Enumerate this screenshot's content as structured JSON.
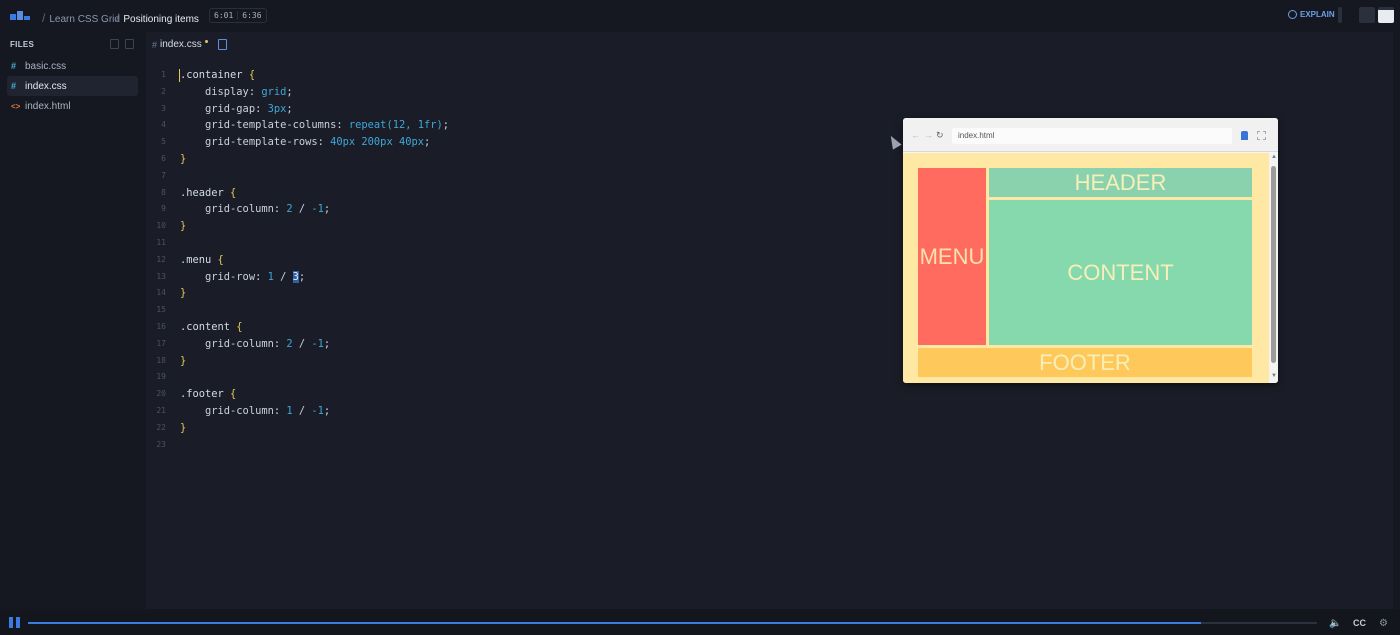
{
  "topbar": {
    "breadcrumb": [
      "Learn CSS Grid",
      "Positioning items"
    ],
    "time_current": "6:01",
    "time_total": "6:36",
    "explain_label": "EXPLAIN",
    "accent": "#3b7be0"
  },
  "sidebar": {
    "title": "FILES",
    "files": [
      {
        "type": "#",
        "name": "basic.css",
        "active": false
      },
      {
        "type": "#",
        "name": "index.css",
        "active": true
      },
      {
        "type": "<>",
        "name": "index.html",
        "active": false
      }
    ]
  },
  "editor": {
    "tab": {
      "hash": "#",
      "name": "index.css",
      "modified": true
    },
    "lines": [
      {
        "n": "1",
        "sel": ".container",
        "brace": " {"
      },
      {
        "n": "2",
        "prop": "    display: ",
        "val": "grid",
        "end": ";"
      },
      {
        "n": "3",
        "prop": "    grid-gap: ",
        "val": "3px",
        "end": ";"
      },
      {
        "n": "4",
        "prop": "    grid-template-columns: ",
        "val": "repeat(12, 1fr)",
        "end": ";"
      },
      {
        "n": "5",
        "prop": "    grid-template-rows: ",
        "val": "40px 200px 40px",
        "end": ";"
      },
      {
        "n": "6",
        "brace": "}"
      },
      {
        "n": "7"
      },
      {
        "n": "8",
        "sel": ".header",
        "brace": " {"
      },
      {
        "n": "9",
        "prop": "    grid-column: ",
        "val": "2",
        "mid": " / ",
        "val2": "-1",
        "end": ";"
      },
      {
        "n": "10",
        "brace": "}"
      },
      {
        "n": "11"
      },
      {
        "n": "12",
        "sel": ".menu",
        "brace": " {"
      },
      {
        "n": "13",
        "prop": "    grid-row: ",
        "val": "1",
        "mid": " / ",
        "val2": "3",
        "end": ";"
      },
      {
        "n": "14",
        "brace": "}"
      },
      {
        "n": "15"
      },
      {
        "n": "16",
        "sel": ".content",
        "brace": " {"
      },
      {
        "n": "17",
        "prop": "    grid-column: ",
        "val": "2",
        "mid": " / ",
        "val2": "-1",
        "end": ";"
      },
      {
        "n": "18",
        "brace": "}"
      },
      {
        "n": "19"
      },
      {
        "n": "20",
        "sel": ".footer",
        "brace": " {"
      },
      {
        "n": "21",
        "prop": "    grid-column: ",
        "val": "1",
        "mid": " / ",
        "val2": "-1",
        "end": ";"
      },
      {
        "n": "22",
        "brace": "}"
      },
      {
        "n": "23"
      }
    ]
  },
  "preview": {
    "url": "index.html",
    "nav_back": "←",
    "nav_forward": "→",
    "reload": "↻",
    "cells": {
      "menu": "MENU",
      "header": "HEADER",
      "content": "CONTENT",
      "footer": "FOOTER"
    }
  },
  "player": {
    "progress_fraction": 0.91,
    "speaker_icon": "🔈",
    "cc_label": "CC",
    "settings_icon": "⚙"
  }
}
